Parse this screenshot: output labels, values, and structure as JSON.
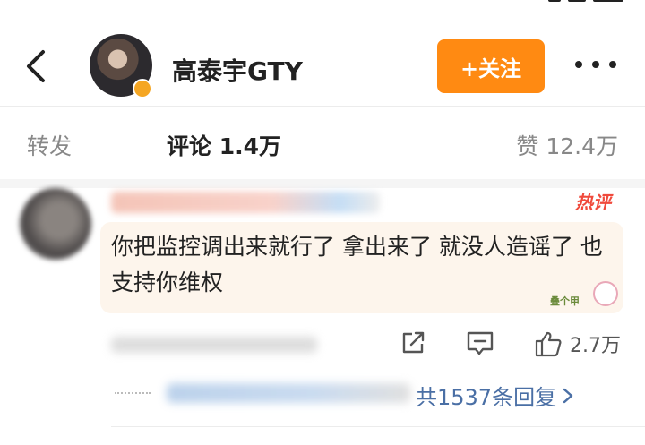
{
  "header": {
    "username": "高泰宇GTY",
    "follow_label": "+关注"
  },
  "tabs": {
    "repost": "转发",
    "comment": "评论 1.4万",
    "like": "赞 12.4万"
  },
  "comment": {
    "hot_tag": "热评",
    "text": "你把监控调出来就行了 拿出来了 就没人造谣了 也支持你维权",
    "sticker_label": "叠个甲",
    "like_count": "2.7万",
    "reply_summary": "共1537条回复"
  },
  "colors": {
    "accent": "#ff8a12",
    "link": "#4a6fa5",
    "hot": "#f04a3c"
  }
}
